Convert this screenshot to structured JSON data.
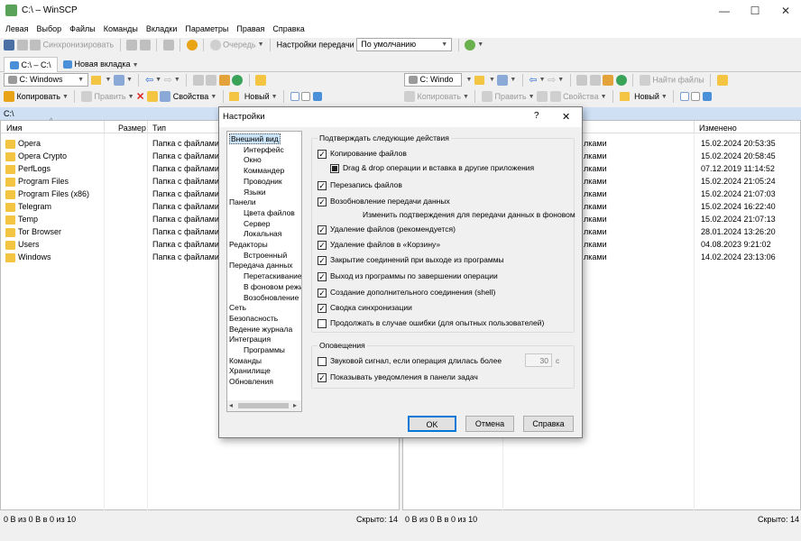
{
  "window": {
    "title": "C:\\ – WinSCP",
    "minimize": "—",
    "maximize": "☐",
    "close": "✕"
  },
  "menu": [
    "Левая",
    "Выбор",
    "Файлы",
    "Команды",
    "Вкладки",
    "Параметры",
    "Правая",
    "Справка"
  ],
  "toolbar": {
    "sync": "Синхронизировать",
    "queue": "Очередь",
    "transfer_settings": "Настройки передачи",
    "transfer_preset": "По умолчанию"
  },
  "tabs": {
    "current": "C:\\ – C:\\",
    "new_tab": "Новая вкладка"
  },
  "left": {
    "drive": "C: Windows",
    "copy": "Копировать",
    "edit": "Править",
    "properties": "Свойства",
    "new": "Новый",
    "path": "C:\\",
    "columns": {
      "name": "Имя",
      "size": "Размер",
      "type": "Тип"
    },
    "rows": [
      {
        "name": "Opera",
        "type": "Папка с файлами"
      },
      {
        "name": "Opera Crypto",
        "type": "Папка с файлами"
      },
      {
        "name": "PerfLogs",
        "type": "Папка с файлами"
      },
      {
        "name": "Program Files",
        "type": "Папка с файлами"
      },
      {
        "name": "Program Files (x86)",
        "type": "Папка с файлами"
      },
      {
        "name": "Telegram",
        "type": "Папка с файлами"
      },
      {
        "name": "Temp",
        "type": "Папка с файлами"
      },
      {
        "name": "Tor Browser",
        "type": "Папка с файлами"
      },
      {
        "name": "Users",
        "type": "Папка с файлами"
      },
      {
        "name": "Windows",
        "type": "Папка с файлами"
      }
    ],
    "status_left": "0 B из 0 B в 0 из 10",
    "status_right": "Скрыто: 14"
  },
  "right": {
    "drive": "C: Windo",
    "find_files": "Найти файлы",
    "copy": "Копировать",
    "edit": "Править",
    "properties": "Свойства",
    "new": "Новый",
    "changed_header": "Изменено",
    "type_fragment": "лками",
    "dates": [
      "15.02.2024 20:53:35",
      "15.02.2024 20:58:45",
      "07.12.2019 11:14:52",
      "15.02.2024 21:05:24",
      "15.02.2024 21:07:03",
      "15.02.2024 16:22:40",
      "15.02.2024 21:07:13",
      "28.01.2024 13:26:20",
      "04.08.2023 9:21:02",
      "14.02.2024 23:13:06"
    ],
    "status_left": "0 B из 0 B в 0 из 10",
    "status_right": "Скрыто: 14"
  },
  "dialog": {
    "title": "Настройки",
    "help_glyph": "?",
    "close_glyph": "✕",
    "tree": [
      {
        "label": "Внешний вид",
        "level": 0,
        "selected": true
      },
      {
        "label": "Интерфейс",
        "level": 1
      },
      {
        "label": "Окно",
        "level": 1
      },
      {
        "label": "Коммандер",
        "level": 1
      },
      {
        "label": "Проводник",
        "level": 1
      },
      {
        "label": "Языки",
        "level": 1
      },
      {
        "label": "Панели",
        "level": 0
      },
      {
        "label": "Цвета файлов",
        "level": 1
      },
      {
        "label": "Сервер",
        "level": 1
      },
      {
        "label": "Локальная",
        "level": 1
      },
      {
        "label": "Редакторы",
        "level": 0
      },
      {
        "label": "Встроенный",
        "level": 1
      },
      {
        "label": "Передача данных",
        "level": 0
      },
      {
        "label": "Перетаскивание",
        "level": 1
      },
      {
        "label": "В фоновом режим",
        "level": 1
      },
      {
        "label": "Возобновление",
        "level": 1
      },
      {
        "label": "Сеть",
        "level": 0
      },
      {
        "label": "Безопасность",
        "level": 0
      },
      {
        "label": "Ведение журнала",
        "level": 0
      },
      {
        "label": "Интеграция",
        "level": 0
      },
      {
        "label": "Программы",
        "level": 1
      },
      {
        "label": "Команды",
        "level": 0
      },
      {
        "label": "Хранилище",
        "level": 0
      },
      {
        "label": "Обновления",
        "level": 0
      }
    ],
    "confirm_group": "Подтверждать следующие действия",
    "confirm_items": [
      {
        "label": "Копирование файлов",
        "checked": true
      },
      {
        "label": "Drag & drop операции и вставка в другие приложения",
        "checked": true,
        "indeterminate": true
      },
      {
        "label": "Перезапись файлов",
        "checked": true
      },
      {
        "label": "Возобновление передачи данных",
        "checked": true
      },
      {
        "label": "Изменить подтверждения для передачи данных в фоновом",
        "note": true
      },
      {
        "label": "Удаление файлов (рекомендуется)",
        "checked": true
      },
      {
        "label": "Удаление файлов в «Корзину»",
        "checked": true
      },
      {
        "label": "Закрытие соединений при выходе из программы",
        "checked": true
      },
      {
        "label": "Выход из программы по завершении операции",
        "checked": true
      },
      {
        "label": "Создание дополнительного соединения (shell)",
        "checked": true
      },
      {
        "label": "Сводка синхронизации",
        "checked": true
      },
      {
        "label": "Продолжать в случае ошибки (для опытных пользователей)",
        "checked": false
      }
    ],
    "notify_group": "Оповещения",
    "sound_label": "Звуковой сигнал, если операция длилась более",
    "sound_checked": false,
    "sound_value": "30",
    "sound_unit": "с",
    "taskbar_label": "Показывать уведомления в панели задач",
    "taskbar_checked": true,
    "ok": "OK",
    "cancel": "Отмена",
    "help": "Справка"
  }
}
